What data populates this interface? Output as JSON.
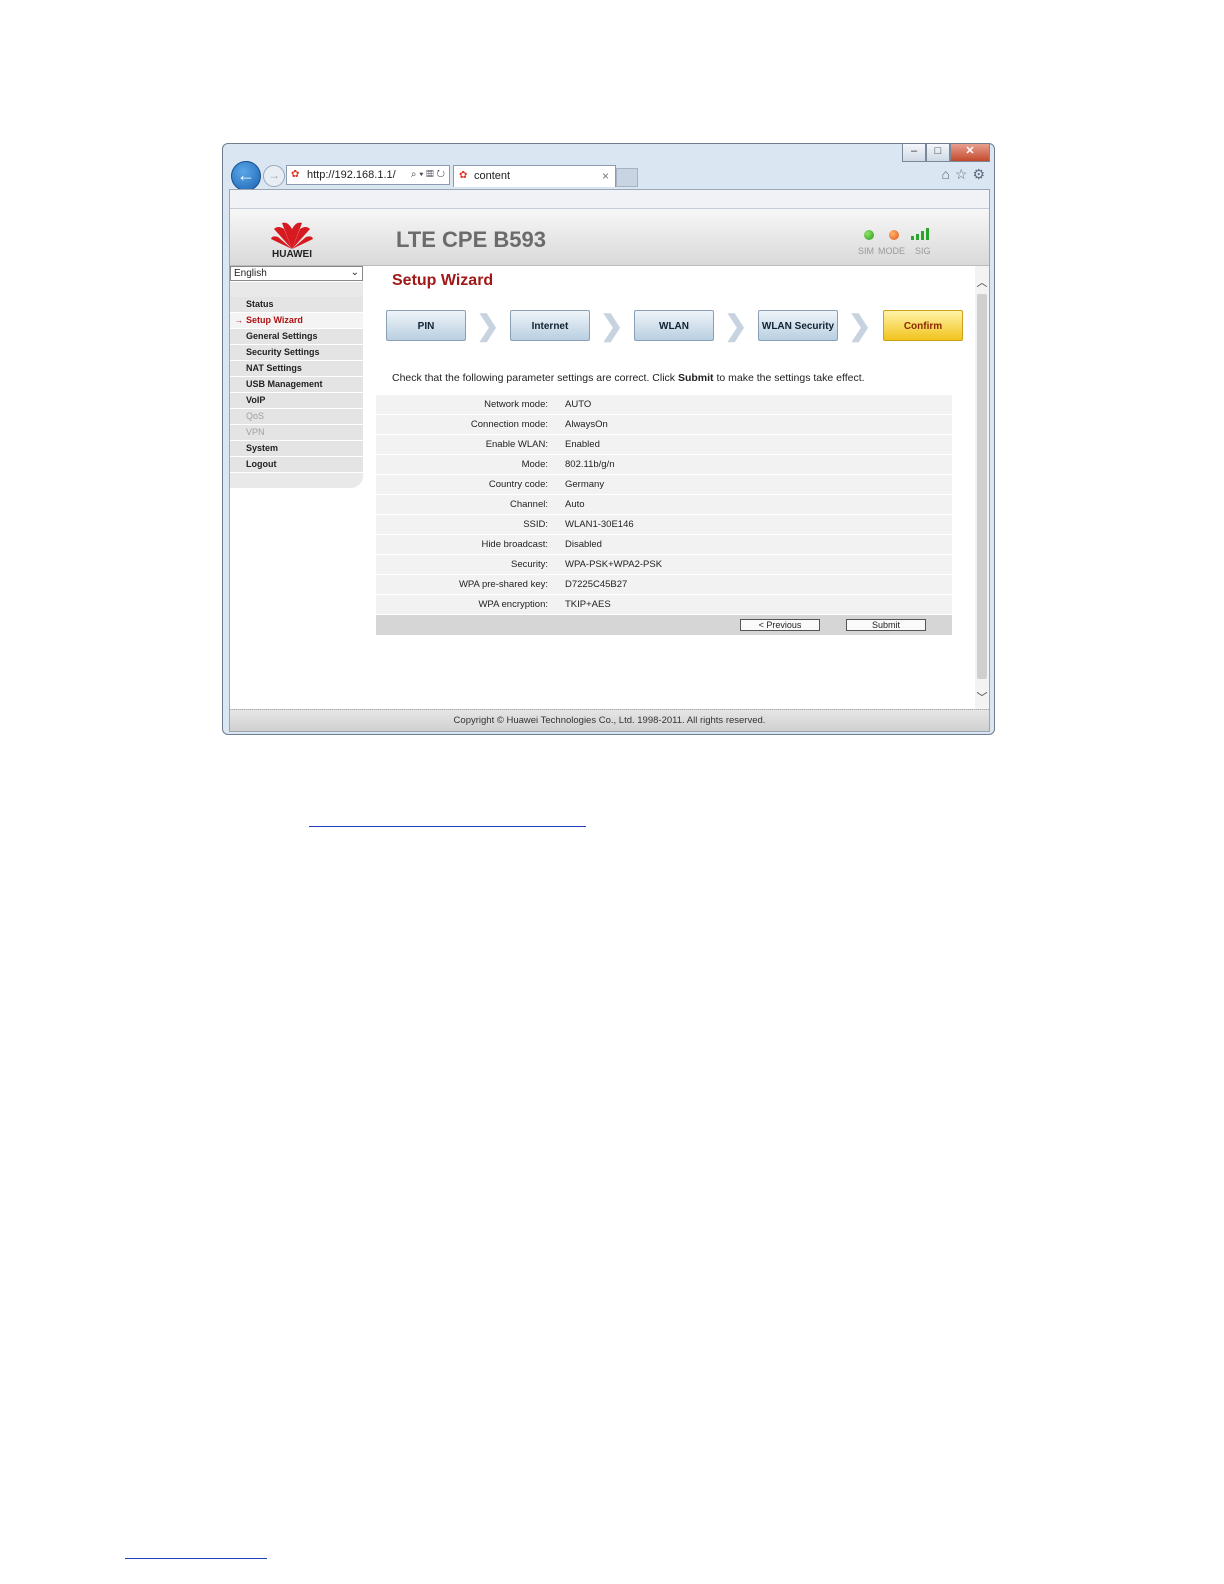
{
  "browser": {
    "address": "http://192.168.1.1/",
    "address_tools": "⌕ ▾ ▦ ↻",
    "tab_title": "content",
    "tab_close": "×",
    "win_min": "–",
    "win_max": "□",
    "win_close": "✕",
    "back": "←",
    "forward": "→",
    "right_icons": "⌂☆⚙"
  },
  "header": {
    "brand": "HUAWEI",
    "product": "LTE CPE B593",
    "indicators": {
      "sim_label": "SIM",
      "mode_label": "MODE",
      "sig_label": "SIG"
    }
  },
  "language": {
    "selected": "English"
  },
  "menu": [
    {
      "label": "Status",
      "state": "normal"
    },
    {
      "label": "Setup Wizard",
      "state": "active"
    },
    {
      "label": "General Settings",
      "state": "normal"
    },
    {
      "label": "Security Settings",
      "state": "normal"
    },
    {
      "label": "NAT Settings",
      "state": "normal"
    },
    {
      "label": "USB Management",
      "state": "normal"
    },
    {
      "label": "VoIP",
      "state": "normal"
    },
    {
      "label": "QoS",
      "state": "disabled"
    },
    {
      "label": "VPN",
      "state": "disabled"
    },
    {
      "label": "System",
      "state": "normal"
    },
    {
      "label": "Logout",
      "state": "normal"
    }
  ],
  "wizard": {
    "title": "Setup Wizard",
    "steps": [
      "PIN",
      "Internet",
      "WLAN",
      "WLAN Security",
      "Confirm"
    ],
    "current_step": "Confirm",
    "instruction_pre": "Check that the following parameter settings are correct. Click ",
    "instruction_bold": "Submit",
    "instruction_post": " to make the settings take effect.",
    "params": [
      {
        "key": "Network mode:",
        "value": "AUTO"
      },
      {
        "key": "Connection mode:",
        "value": "AlwaysOn"
      },
      {
        "key": "Enable WLAN:",
        "value": "Enabled"
      },
      {
        "key": "Mode:",
        "value": "802.11b/g/n"
      },
      {
        "key": "Country code:",
        "value": "Germany"
      },
      {
        "key": "Channel:",
        "value": "Auto"
      },
      {
        "key": "SSID:",
        "value": "WLAN1-30E146"
      },
      {
        "key": "Hide broadcast:",
        "value": "Disabled"
      },
      {
        "key": "Security:",
        "value": "WPA-PSK+WPA2-PSK"
      },
      {
        "key": "WPA pre-shared key:",
        "value": "D7225C45B27"
      },
      {
        "key": "WPA encryption:",
        "value": "TKIP+AES"
      }
    ],
    "previous_label": "< Previous",
    "submit_label": "Submit"
  },
  "footer": {
    "copyright": "Copyright © Huawei Technologies Co., Ltd. 1998-2011. All rights reserved."
  },
  "colors": {
    "title_red": "#a01818",
    "confirm_yellow": "#f1c31d",
    "step_blue": "#b9cfe0"
  }
}
